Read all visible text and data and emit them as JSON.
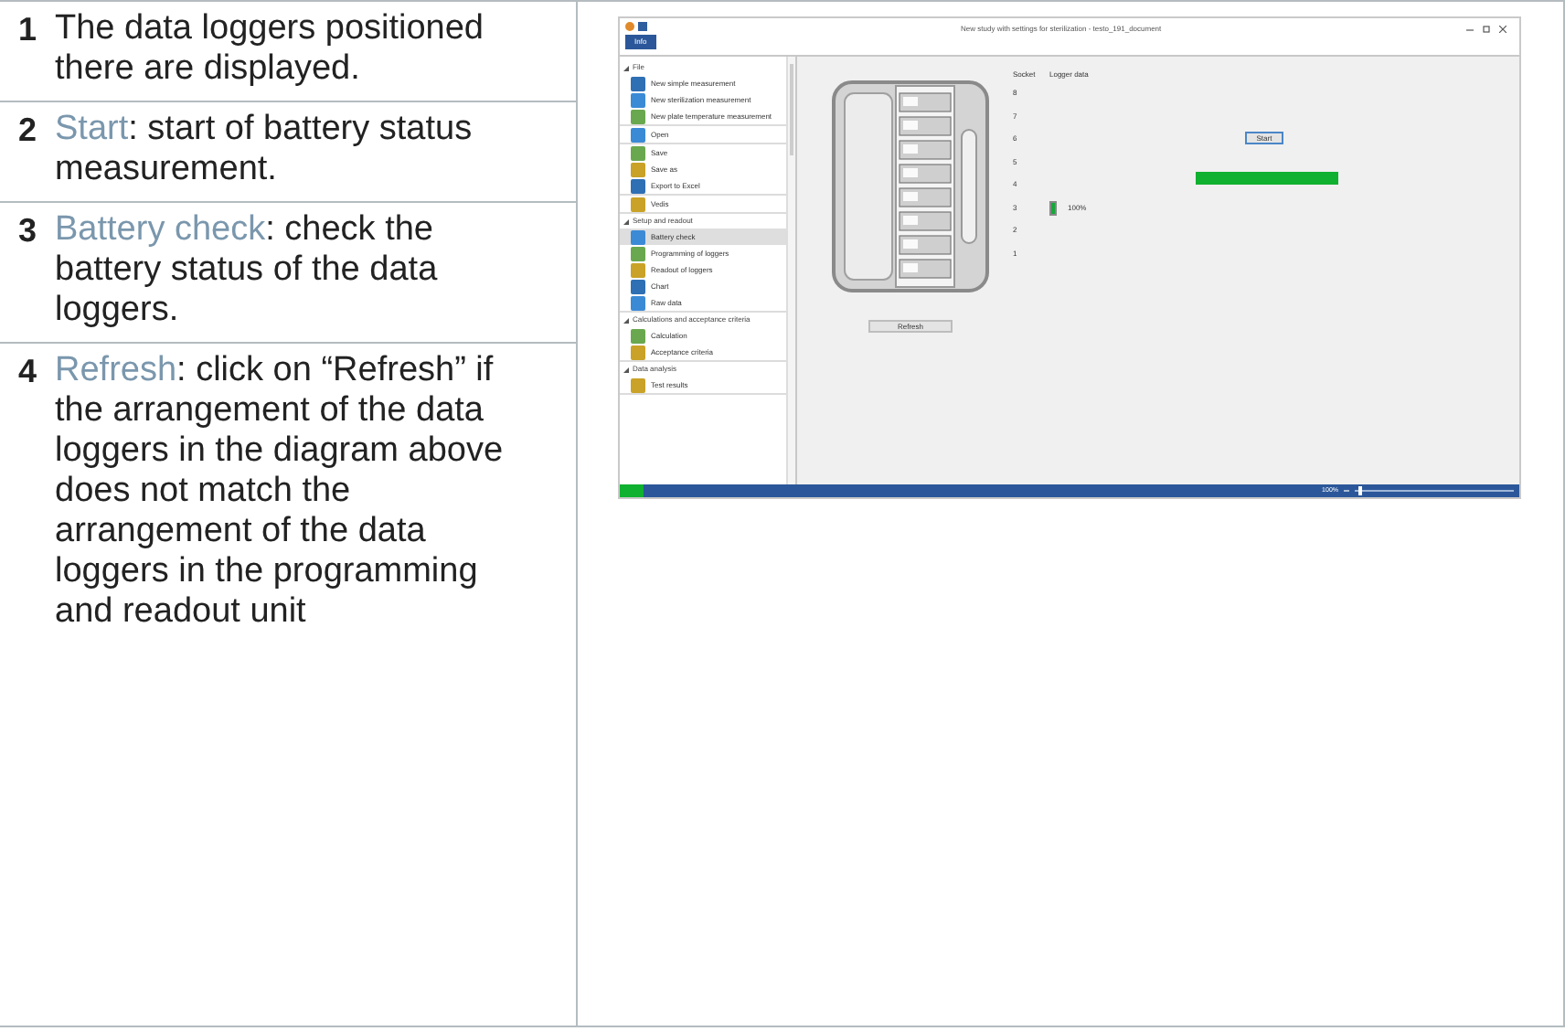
{
  "steps": [
    {
      "number": "1",
      "text": "The data loggers positioned there are displayed."
    },
    {
      "number": "2",
      "term": "Start",
      "text": ": start of battery status measurement."
    },
    {
      "number": "3",
      "term": "Battery check",
      "text": ": check the battery status of the data loggers."
    },
    {
      "number": "4",
      "term": "Refresh",
      "text": ": click on “Refresh” if the arrangement of the data loggers in the diagram above does not match the arrangement of the data loggers in the programming and readout unit"
    }
  ],
  "app": {
    "title": "New study with settings for sterilization - testo_191_document",
    "tab": "Info",
    "sidebar": [
      {
        "label": "File",
        "expanded": true,
        "groups": [
          [
            {
              "label": "New simple measurement",
              "selected": false
            },
            {
              "label": "New sterilization measurement",
              "selected": false
            },
            {
              "label": "New plate temperature measurement",
              "selected": false
            }
          ],
          [
            {
              "label": "Open",
              "selected": false
            }
          ],
          [
            {
              "label": "Save",
              "selected": false
            },
            {
              "label": "Save as",
              "selected": false
            },
            {
              "label": "Export to Excel",
              "selected": false
            }
          ],
          [
            {
              "label": "Vedis",
              "selected": false
            }
          ]
        ]
      },
      {
        "label": "Setup and readout",
        "expanded": true,
        "groups": [
          [
            {
              "label": "Battery check",
              "selected": true
            },
            {
              "label": "Programming of loggers",
              "selected": false
            },
            {
              "label": "Readout of loggers",
              "selected": false
            },
            {
              "label": "Chart",
              "selected": false
            },
            {
              "label": "Raw data",
              "selected": false
            }
          ]
        ]
      },
      {
        "label": "Calculations and acceptance criteria",
        "expanded": true,
        "groups": [
          [
            {
              "label": "Calculation",
              "selected": false
            },
            {
              "label": "Acceptance criteria",
              "selected": false
            }
          ]
        ]
      },
      {
        "label": "Data analysis",
        "expanded": true,
        "groups": [
          [
            {
              "label": "Test results",
              "selected": false
            }
          ]
        ]
      }
    ],
    "columns": [
      "Socket",
      "Logger data"
    ],
    "sockets": [
      {
        "label": "8"
      },
      {
        "label": "7"
      },
      {
        "label": "6"
      },
      {
        "label": "5"
      },
      {
        "label": "4"
      },
      {
        "label": "3",
        "battery": "100%"
      },
      {
        "label": "2"
      },
      {
        "label": "1"
      }
    ],
    "start_button": "Start",
    "progress": {
      "level": 1
    },
    "refresh_button": "Refresh",
    "zoom": "100%",
    "zoom_slider": {
      "level": 0.02
    }
  }
}
